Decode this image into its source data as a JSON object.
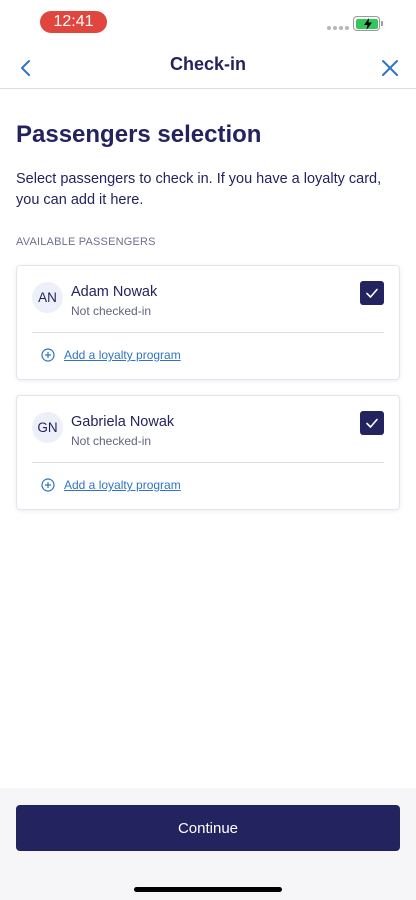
{
  "status_bar": {
    "time": "12:41",
    "time_pill_color": "#e0463d",
    "battery_color": "#34c759"
  },
  "nav": {
    "title": "Check-in",
    "back_icon": "chevron-left-icon",
    "close_icon": "close-icon",
    "icon_color": "#2f74c6"
  },
  "content": {
    "heading": "Passengers selection",
    "description": "Select passengers to check in. If you have a loyalty card, you can add it here.",
    "section_label": "AVAILABLE PASSENGERS"
  },
  "passengers": [
    {
      "initials": "AN",
      "name": "Adam Nowak",
      "status": "Not checked-in",
      "checked": true,
      "loyalty_link": "Add a loyalty program"
    },
    {
      "initials": "GN",
      "name": "Gabriela Nowak",
      "status": "Not checked-in",
      "checked": true,
      "loyalty_link": "Add a loyalty program"
    }
  ],
  "footer": {
    "continue_label": "Continue"
  },
  "colors": {
    "primary": "#23235f",
    "link": "#2f74c6",
    "footer_background": "#f6f6f8"
  }
}
